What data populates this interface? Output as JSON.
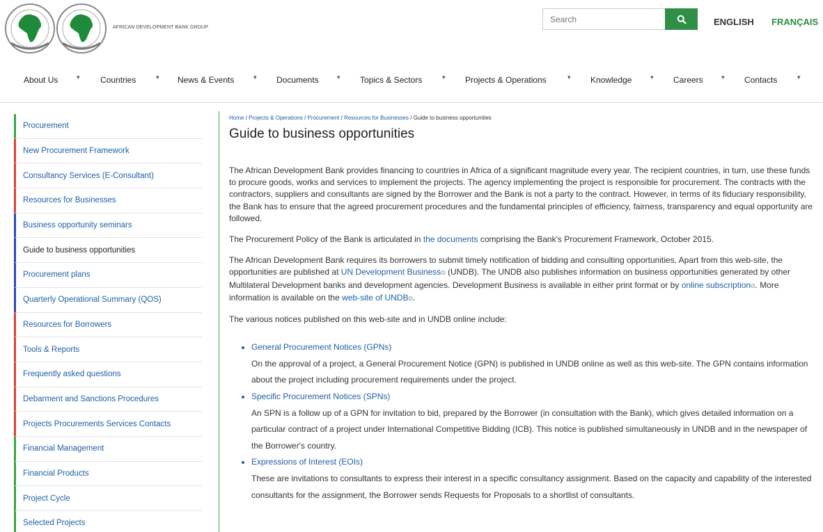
{
  "header": {
    "logo_text": "AFRICAN DEVELOPMENT BANK GROUP",
    "search_placeholder": "Search",
    "lang_english": "ENGLISH",
    "lang_french": "FRANÇAIS"
  },
  "nav": {
    "items": [
      {
        "label": "About Us"
      },
      {
        "label": "Countries"
      },
      {
        "label": "News & Events"
      },
      {
        "label": "Documents"
      },
      {
        "label": "Topics & Sectors"
      },
      {
        "label": "Projects & Operations"
      },
      {
        "label": "Knowledge"
      },
      {
        "label": "Careers"
      },
      {
        "label": "Contacts"
      }
    ]
  },
  "sidebar": {
    "items": [
      {
        "label": "Procurement"
      },
      {
        "label": "New Procurement Framework"
      },
      {
        "label": "Consultancy Services (E-Consultant)"
      },
      {
        "label": "Resources for Businesses"
      },
      {
        "label": "Business opportunity seminars"
      },
      {
        "label": "Guide to business opportunities"
      },
      {
        "label": "Procurement plans"
      },
      {
        "label": "Quarterly Operational Summary (QOS)"
      },
      {
        "label": "Resources for Borrowers"
      },
      {
        "label": "Tools & Reports"
      },
      {
        "label": "Frequently asked questions"
      },
      {
        "label": "Debarment and Sanctions Procedures"
      },
      {
        "label": "Projects Procurements Services Contacts"
      },
      {
        "label": "Financial Management"
      },
      {
        "label": "Financial Products"
      },
      {
        "label": "Project Cycle"
      },
      {
        "label": "Selected Projects"
      }
    ]
  },
  "breadcrumb": {
    "home": "Home",
    "projects": "Projects & Operations",
    "procurement": "Procurement",
    "resources": "Resources for Businesses",
    "current": "Guide to business opportunities",
    "separator": "/"
  },
  "content": {
    "title": "Guide to business opportunities",
    "p1": "The African Development Bank provides financing to countries in Africa of a significant magnitude every year. The recipient countries, in turn, use these funds to procure goods, works and services to implement the projects. The agency implementing the project is responsible for procurement. The contracts with the contractors, suppliers and consultants are signed by the Borrower and the Bank is not a party to the contract. However, in terms of its fiduciary responsibility, the Bank has to ensure that the agreed procurement procedures and the fundamental principles of efficiency, fairness, transparency and equal opportunity are followed.",
    "p2_a": "The Procurement Policy of the Bank is articulated in ",
    "p2_link": "the documents",
    "p2_b": " comprising the Bank's Procurement Framework, October 2015.",
    "p3_a": "The African Development Bank requires its borrowers to submit timely notification of bidding and consulting opportunities. Apart from this web-site, the opportunities are published at ",
    "p3_link1": "UN Development Business",
    "p3_b": " (UNDB). The UNDB also publishes information on business opportunities generated by other Multilateral Development banks and development agencies. Development Business is available in either print format or by ",
    "p3_link2": "online subscription",
    "p3_c": ". More information is available on the ",
    "p3_link3": "web-site of UNDB",
    "p3_d": ".",
    "p4": "The various notices published on this web-site and in UNDB online include:",
    "notices": [
      {
        "title": "General Procurement Notices (GPNs)",
        "desc": "On the approval of a project, a General Procurement Notice (GPN) is published in UNDB online as well as this web-site. The GPN contains information about the project including procurement requirements under the project."
      },
      {
        "title": "Specific Procurement Notices (SPNs)",
        "desc": "An SPN is a follow up of a GPN for invitation to bid, prepared by the Borrower (in consultation with the Bank), which gives detailed information on a particular contract of a project under International Competitive Bidding (ICB). This notice is published simultaneously in UNDB and in the newspaper of the Borrower's country."
      },
      {
        "title": "Expressions of Interest (EOIs)",
        "desc": "These are invitations to consultants to express their interest in a specific consultancy assignment. Based on the capacity and capability of the interested consultants for the assignment, the Borrower sends Requests for Proposals to a shortlist of consultants."
      }
    ]
  },
  "colors": {
    "brand_green": "#2f8f46",
    "link_blue": "#1f5fa6",
    "side_red": "#d9413c",
    "side_blue": "#3348b8",
    "side_green": "#3aa34a"
  },
  "icons": {
    "search_button": "search-icon",
    "nav_caret": "caret-down-icon",
    "external_link": "external-link-icon"
  }
}
